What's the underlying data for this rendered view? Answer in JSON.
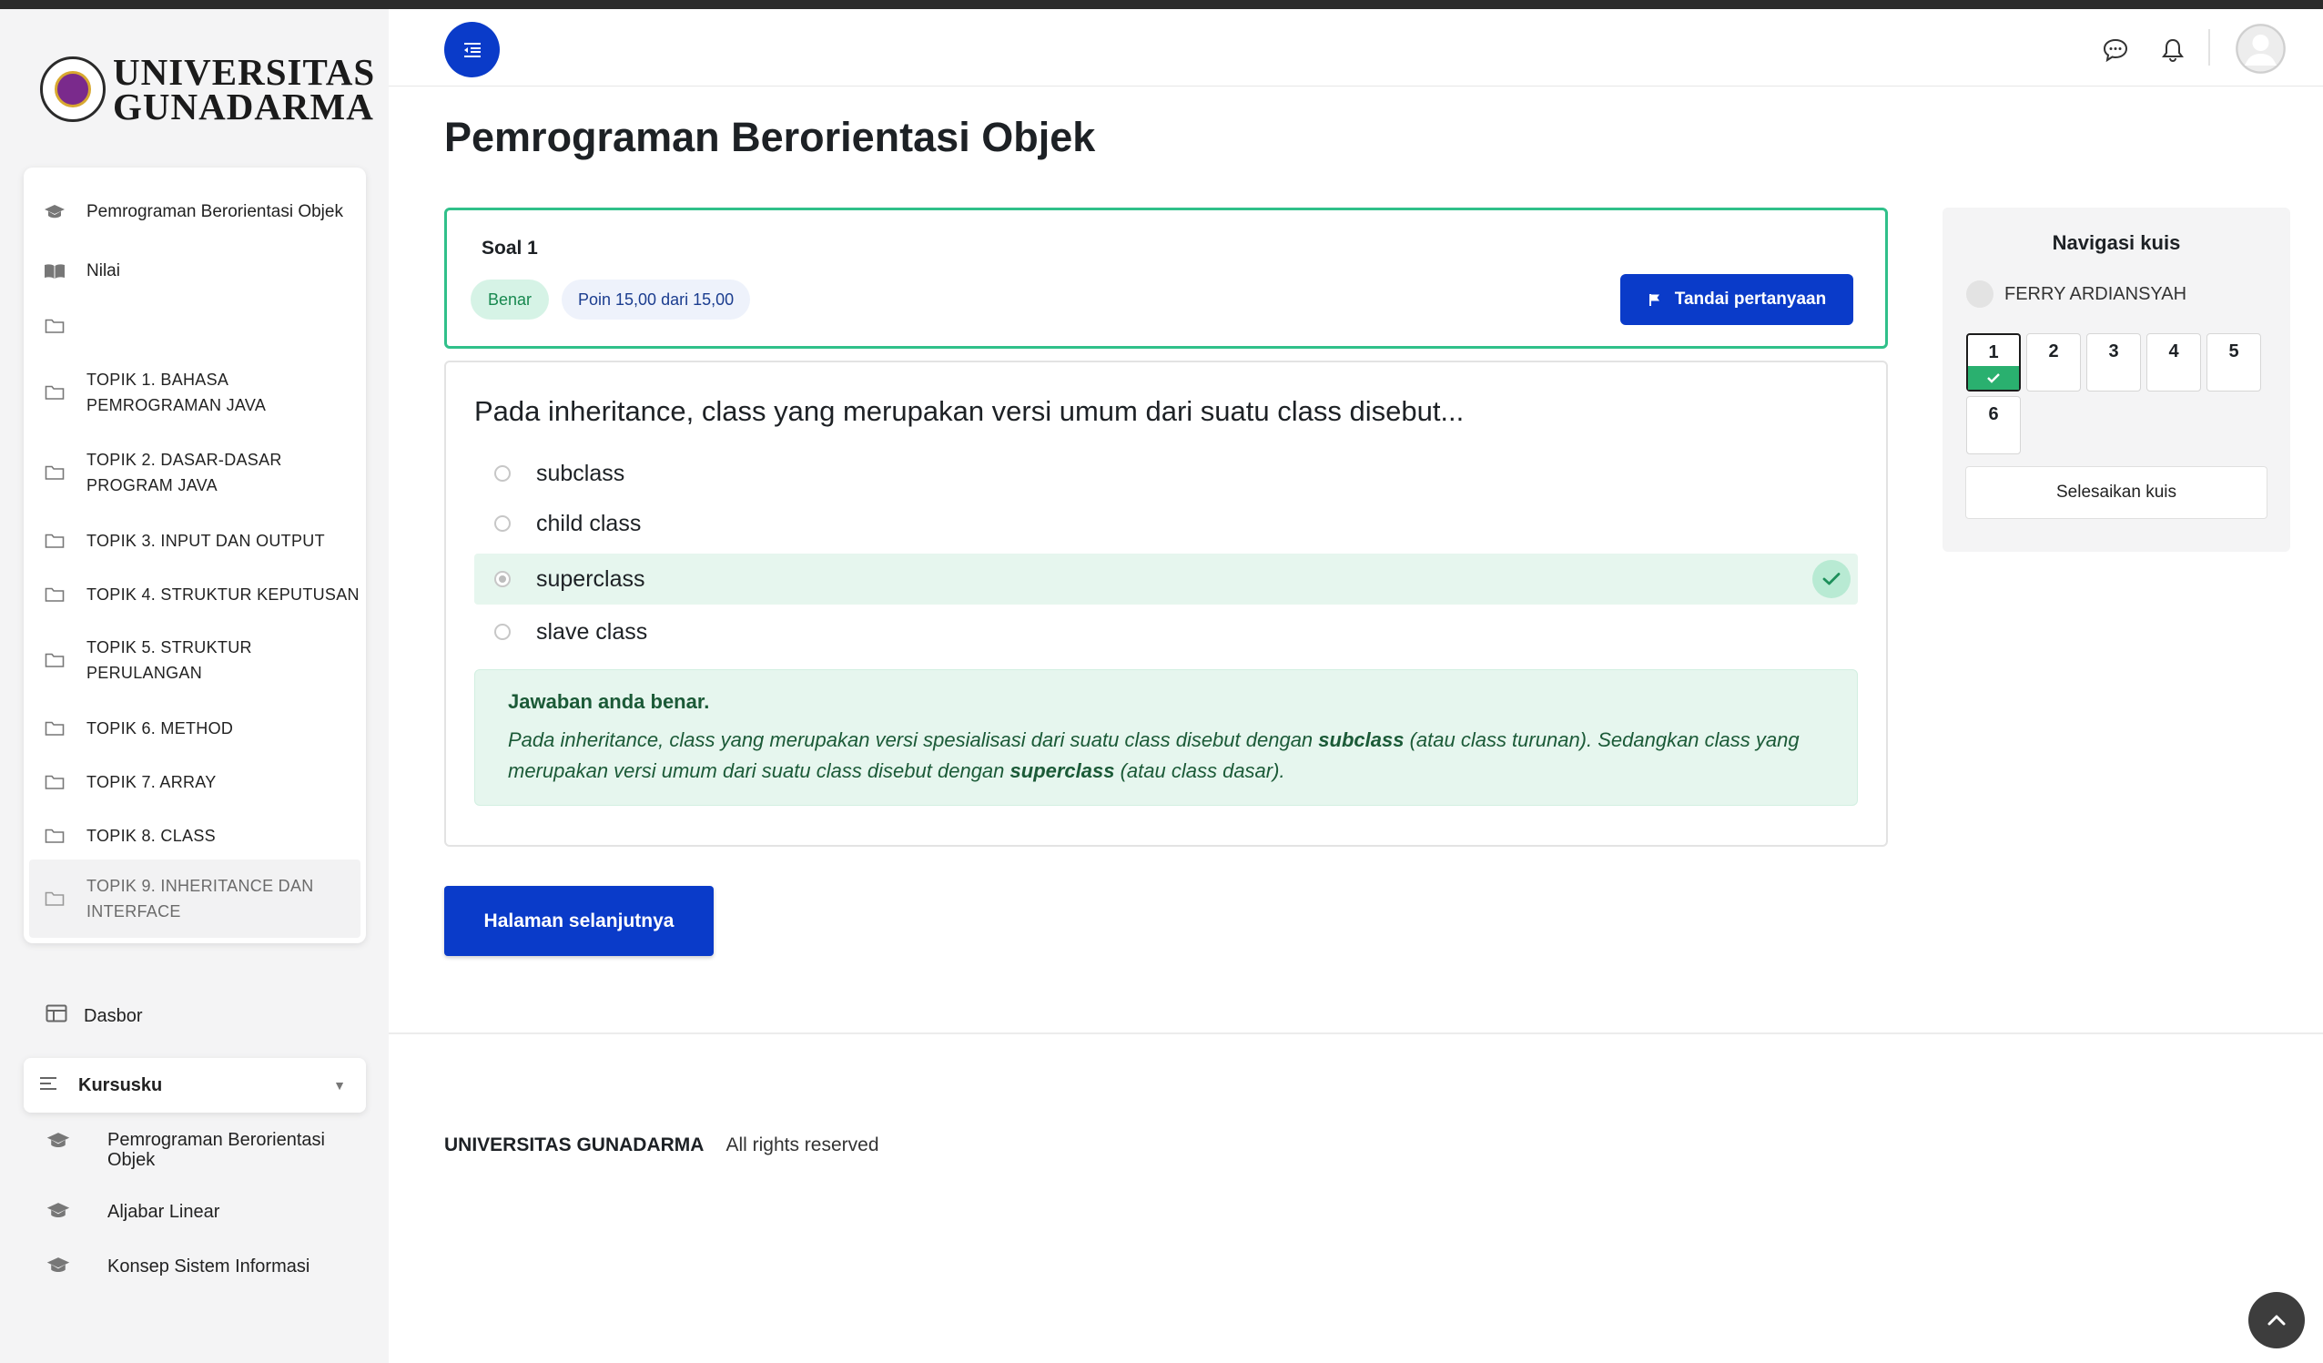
{
  "branding": {
    "logo_line1": "UNIVERSITAS",
    "logo_line2": "GUNADARMA"
  },
  "course_nav": {
    "items": [
      {
        "label": "Pemrograman Berorientasi Objek",
        "icon": "graduation-cap-icon"
      },
      {
        "label": "Nilai",
        "icon": "book-open-icon"
      },
      {
        "label": "",
        "icon": "folder-icon"
      },
      {
        "label": "TOPIK 1. BAHASA PEMROGRAMAN JAVA",
        "icon": "folder-icon"
      },
      {
        "label": "TOPIK 2. DASAR-DASAR PROGRAM JAVA",
        "icon": "folder-icon"
      },
      {
        "label": "TOPIK 3. INPUT DAN OUTPUT",
        "icon": "folder-icon"
      },
      {
        "label": "TOPIK 4. STRUKTUR KEPUTUSAN",
        "icon": "folder-icon"
      },
      {
        "label": "TOPIK 5. STRUKTUR PERULANGAN",
        "icon": "folder-icon"
      },
      {
        "label": "TOPIK 6. METHOD",
        "icon": "folder-icon"
      },
      {
        "label": "TOPIK 7. ARRAY",
        "icon": "folder-icon"
      },
      {
        "label": "TOPIK 8. CLASS",
        "icon": "folder-icon"
      },
      {
        "label": "TOPIK 9. INHERITANCE DAN INTERFACE",
        "icon": "folder-icon"
      }
    ]
  },
  "sidebar": {
    "dasbor_label": "Dasbor",
    "kursusku_label": "Kursusku",
    "my_courses": [
      {
        "label": "Pemrograman Berorientasi Objek"
      },
      {
        "label": "Aljabar Linear"
      },
      {
        "label": "Konsep Sistem Informasi"
      }
    ]
  },
  "page": {
    "title": "Pemrograman Berorientasi Objek"
  },
  "question": {
    "number_label": "Soal 1",
    "status_badge": "Benar",
    "points_badge": "Poin 15,00 dari 15,00",
    "flag_button": "Tandai pertanyaan",
    "text": "Pada inheritance, class yang merupakan versi umum dari suatu class disebut...",
    "options": [
      {
        "label": "subclass",
        "selected": false,
        "correct": false
      },
      {
        "label": "child class",
        "selected": false,
        "correct": false
      },
      {
        "label": "superclass",
        "selected": true,
        "correct": true
      },
      {
        "label": "slave class",
        "selected": false,
        "correct": false
      }
    ],
    "feedback": {
      "title": "Jawaban anda benar.",
      "part1": "Pada inheritance, class yang merupakan versi spesialisasi dari suatu class disebut dengan ",
      "bold1": "subclass",
      "part2": " (atau class turunan). Sedangkan class yang merupakan versi umum dari suatu class disebut dengan ",
      "bold2": "superclass",
      "part3": " (atau class dasar)."
    }
  },
  "next_button": "Halaman selanjutnya",
  "quiz_nav": {
    "title": "Navigasi kuis",
    "user_name": "FERRY ARDIANSYAH",
    "questions": [
      "1",
      "2",
      "3",
      "4",
      "5",
      "6"
    ],
    "answered": [
      "1"
    ],
    "finish_button": "Selesaikan kuis"
  },
  "footer": {
    "brand": "UNIVERSITAS GUNADARMA",
    "rights": "All rights reserved"
  },
  "colors": {
    "primary": "#0a3bc9",
    "success": "#30c08a",
    "success_bg": "#e6f6ee",
    "sidebar_bg": "#f4f4f5"
  }
}
